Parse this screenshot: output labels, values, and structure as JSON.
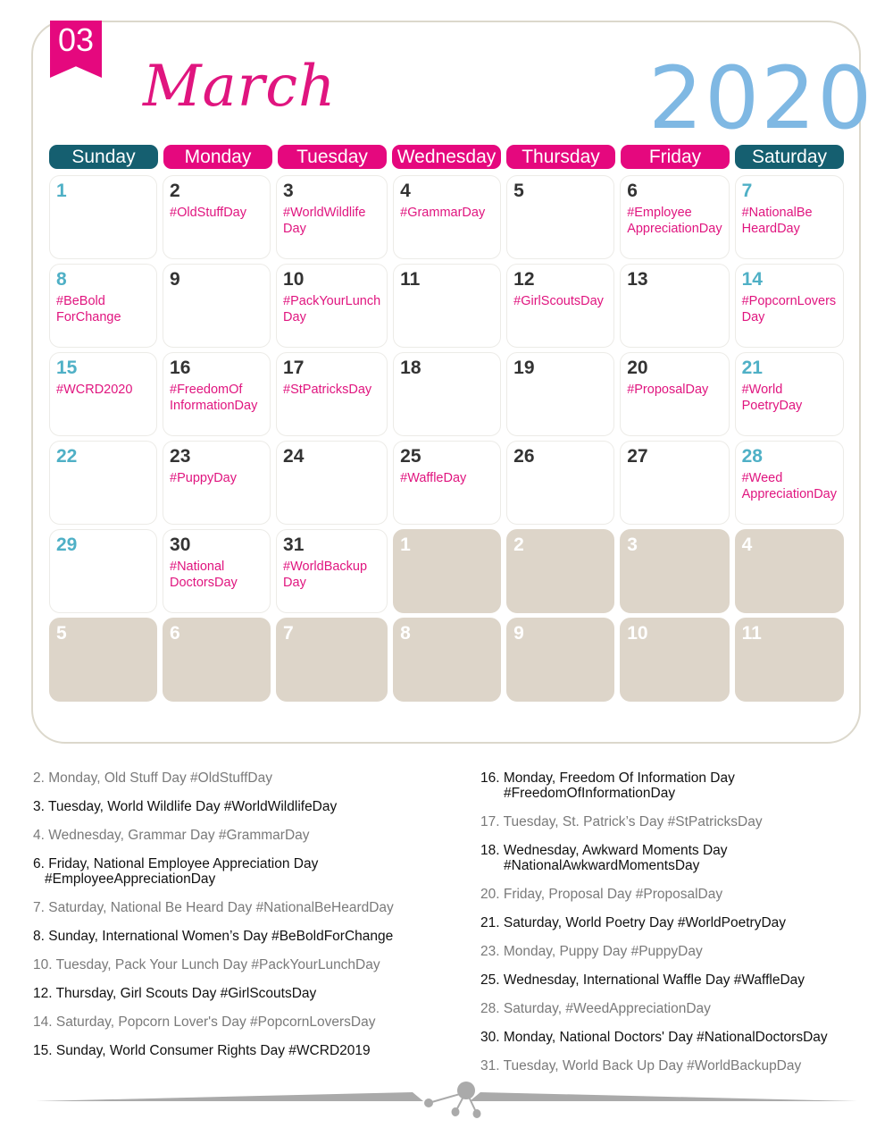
{
  "badge": "03",
  "month": "March",
  "year": "2020",
  "colors": {
    "pink": "#e5087e",
    "teal": "#155f70",
    "year_blue": "#7fb8e3",
    "weekend_num": "#4fb0c6",
    "other_month_bg": "#ddd5c9"
  },
  "weekdays": [
    {
      "label": "Sunday",
      "weekend": true
    },
    {
      "label": "Monday",
      "weekend": false
    },
    {
      "label": "Tuesday",
      "weekend": false
    },
    {
      "label": "Wednesday",
      "weekend": false
    },
    {
      "label": "Thursday",
      "weekend": false
    },
    {
      "label": "Friday",
      "weekend": false
    },
    {
      "label": "Saturday",
      "weekend": true
    }
  ],
  "days": [
    {
      "n": "1",
      "tag": ""
    },
    {
      "n": "2",
      "tag": "#OldStuffDay"
    },
    {
      "n": "3",
      "tag": "#WorldWildlife\nDay"
    },
    {
      "n": "4",
      "tag": "#GrammarDay"
    },
    {
      "n": "5",
      "tag": ""
    },
    {
      "n": "6",
      "tag": "#Employee\nAppreciationDay"
    },
    {
      "n": "7",
      "tag": "#NationalBe\nHeardDay"
    },
    {
      "n": "8",
      "tag": "#BeBold\nForChange"
    },
    {
      "n": "9",
      "tag": ""
    },
    {
      "n": "10",
      "tag": "#PackYourLunch\nDay"
    },
    {
      "n": "11",
      "tag": ""
    },
    {
      "n": "12",
      "tag": "#GirlScoutsDay"
    },
    {
      "n": "13",
      "tag": ""
    },
    {
      "n": "14",
      "tag": "#PopcornLovers\nDay"
    },
    {
      "n": "15",
      "tag": "#WCRD2020"
    },
    {
      "n": "16",
      "tag": "#FreedomOf\nInformationDay"
    },
    {
      "n": "17",
      "tag": "#StPatricksDay"
    },
    {
      "n": "18",
      "tag": ""
    },
    {
      "n": "19",
      "tag": ""
    },
    {
      "n": "20",
      "tag": "#ProposalDay"
    },
    {
      "n": "21",
      "tag": "#World\nPoetryDay"
    },
    {
      "n": "22",
      "tag": ""
    },
    {
      "n": "23",
      "tag": "#PuppyDay"
    },
    {
      "n": "24",
      "tag": ""
    },
    {
      "n": "25",
      "tag": "#WaffleDay"
    },
    {
      "n": "26",
      "tag": ""
    },
    {
      "n": "27",
      "tag": ""
    },
    {
      "n": "28",
      "tag": "#Weed\nAppreciationDay"
    },
    {
      "n": "29",
      "tag": ""
    },
    {
      "n": "30",
      "tag": "#National\nDoctorsDay"
    },
    {
      "n": "31",
      "tag": "#WorldBackup\nDay"
    },
    {
      "n": "1",
      "tag": "",
      "other": true
    },
    {
      "n": "2",
      "tag": "",
      "other": true
    },
    {
      "n": "3",
      "tag": "",
      "other": true
    },
    {
      "n": "4",
      "tag": "",
      "other": true
    },
    {
      "n": "5",
      "tag": "",
      "other": true
    },
    {
      "n": "6",
      "tag": "",
      "other": true
    },
    {
      "n": "7",
      "tag": "",
      "other": true
    },
    {
      "n": "8",
      "tag": "",
      "other": true
    },
    {
      "n": "9",
      "tag": "",
      "other": true
    },
    {
      "n": "10",
      "tag": "",
      "other": true
    },
    {
      "n": "11",
      "tag": "",
      "other": true
    }
  ],
  "events_left": [
    {
      "text": "2. Monday, Old Stuff Day #OldStuffDay",
      "tone": "light"
    },
    {
      "text": "3. Tuesday, World Wildlife Day #WorldWildlifeDay",
      "tone": "dark"
    },
    {
      "text": "4. Wednesday, Grammar Day #GrammarDay",
      "tone": "light"
    },
    {
      "text": "6. Friday, National Employee Appreciation Day",
      "line2": "#EmployeeAppreciationDay",
      "tone": "dark"
    },
    {
      "text": "7. Saturday, National Be Heard Day #NationalBeHeardDay",
      "tone": "light"
    },
    {
      "text": "8. Sunday, International Women’s Day #BeBoldForChange",
      "tone": "dark"
    },
    {
      "text": "10. Tuesday, Pack Your Lunch Day #PackYourLunchDay",
      "tone": "light"
    },
    {
      "text": "12. Thursday, Girl Scouts Day #GirlScoutsDay",
      "tone": "dark"
    },
    {
      "text": "14. Saturday, Popcorn Lover's Day #PopcornLoversDay",
      "tone": "light"
    },
    {
      "text": "15. Sunday, World Consumer Rights Day #WCRD2019",
      "tone": "dark"
    }
  ],
  "events_right": [
    {
      "text": "16. Monday, Freedom Of Information Day",
      "line2": "#FreedomOfInformationDay",
      "tone": "dark"
    },
    {
      "text": "17. Tuesday, St. Patrick’s Day #StPatricksDay",
      "tone": "light"
    },
    {
      "text": "18. Wednesday, Awkward Moments Day",
      "line2": "#NationalAwkwardMomentsDay",
      "tone": "dark"
    },
    {
      "text": "20. Friday, Proposal Day #ProposalDay",
      "tone": "light"
    },
    {
      "text": "21. Saturday, World Poetry Day #WorldPoetryDay",
      "tone": "dark"
    },
    {
      "text": "23. Monday, Puppy Day #PuppyDay",
      "tone": "light"
    },
    {
      "text": "25. Wednesday, International Waffle Day #WaffleDay",
      "tone": "dark"
    },
    {
      "text": "28. Saturday, #WeedAppreciationDay",
      "tone": "light"
    },
    {
      "text": "30. Monday, National Doctors' Day #NationalDoctorsDay",
      "tone": "dark"
    },
    {
      "text": "31. Tuesday, World Back Up Day #WorldBackupDay",
      "tone": "light"
    }
  ]
}
